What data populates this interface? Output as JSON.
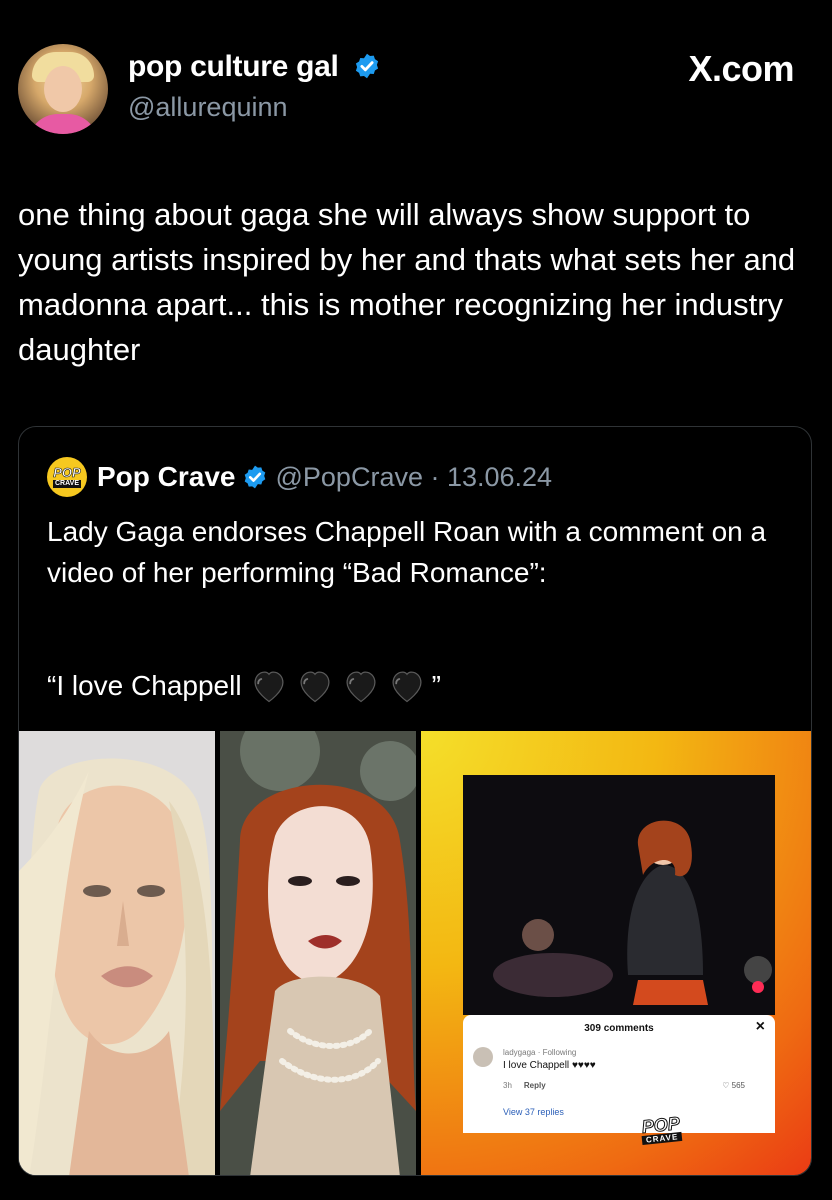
{
  "header": {
    "display_name": "pop culture gal",
    "handle": "@allurequinn",
    "brand": "X.com"
  },
  "tweet": {
    "text": "one thing about gaga she will always show support to young artists inspired by her and thats what sets her and madonna apart... this is mother recognizing her industry daughter"
  },
  "quoted": {
    "logo_text_top": "POP",
    "logo_text_bottom": "CRAVE",
    "display_name": "Pop Crave",
    "handle_date": "@PopCrave · 13.06.24",
    "text": "Lady Gaga endorses Chappell Roan with a comment on a video of her performing “Bad Romance”:",
    "quote_open": "“I love Chappell",
    "quote_close": "”"
  },
  "media": {
    "tiktok": {
      "comments_count": "309 comments",
      "close": "×",
      "user": "ladygaga · Following",
      "comment": "I love Chappell",
      "time": "3h",
      "reply": "Reply",
      "likes": "565",
      "view_replies": "View 37 replies",
      "watermark_top": "POP",
      "watermark_bottom": "CRAVE"
    }
  },
  "colors": {
    "background": "#000000",
    "verified": "#1d9bf0",
    "secondary_text": "#8b98a5",
    "border": "#2f3336"
  }
}
